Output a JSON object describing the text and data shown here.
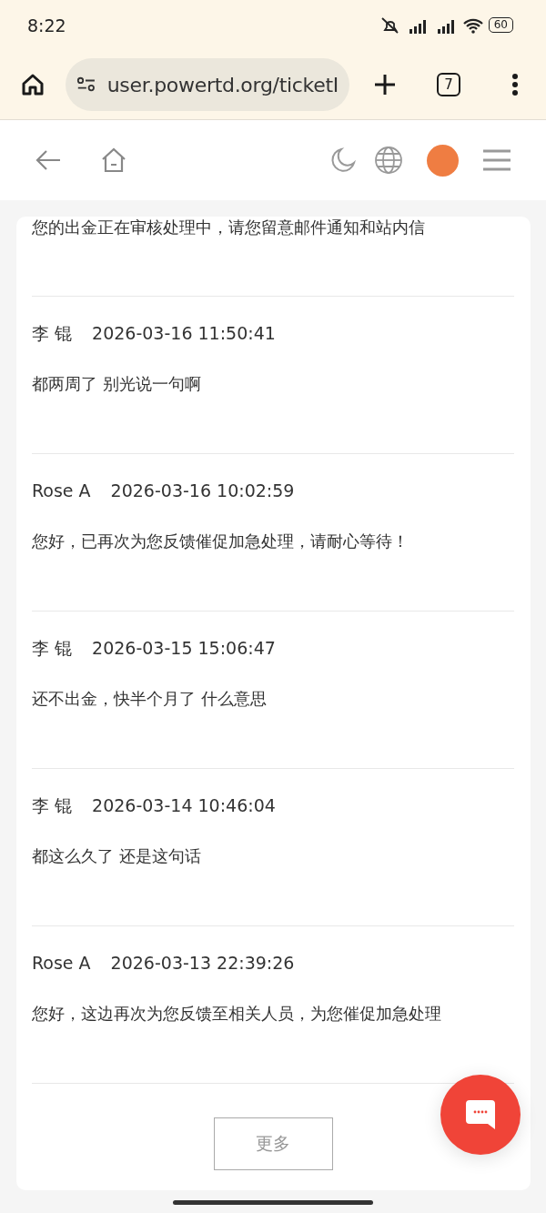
{
  "status_bar": {
    "time": "8:22",
    "battery": "60"
  },
  "browser": {
    "url": "user.powertd.org/ticketI",
    "tab_count": "7"
  },
  "messages": [
    {
      "message": "您的出金正在审核处理中，请您留意邮件通知和站内信"
    },
    {
      "author": "李 锟",
      "time": "2026-03-16 11:50:41",
      "message": "都两周了 别光说一句啊"
    },
    {
      "author": "Rose A",
      "time": "2026-03-16 10:02:59",
      "message": "您好，已再次为您反馈催促加急处理，请耐心等待！"
    },
    {
      "author": "李 锟",
      "time": "2026-03-15 15:06:47",
      "message": "还不出金，快半个月了 什么意思"
    },
    {
      "author": "李 锟",
      "time": "2026-03-14 10:46:04",
      "message": "都这么久了 还是这句话"
    },
    {
      "author": "Rose A",
      "time": "2026-03-13 22:39:26",
      "message": "您好，这边再次为您反馈至相关人员，为您催促加急处理"
    }
  ],
  "more_button": "更多"
}
